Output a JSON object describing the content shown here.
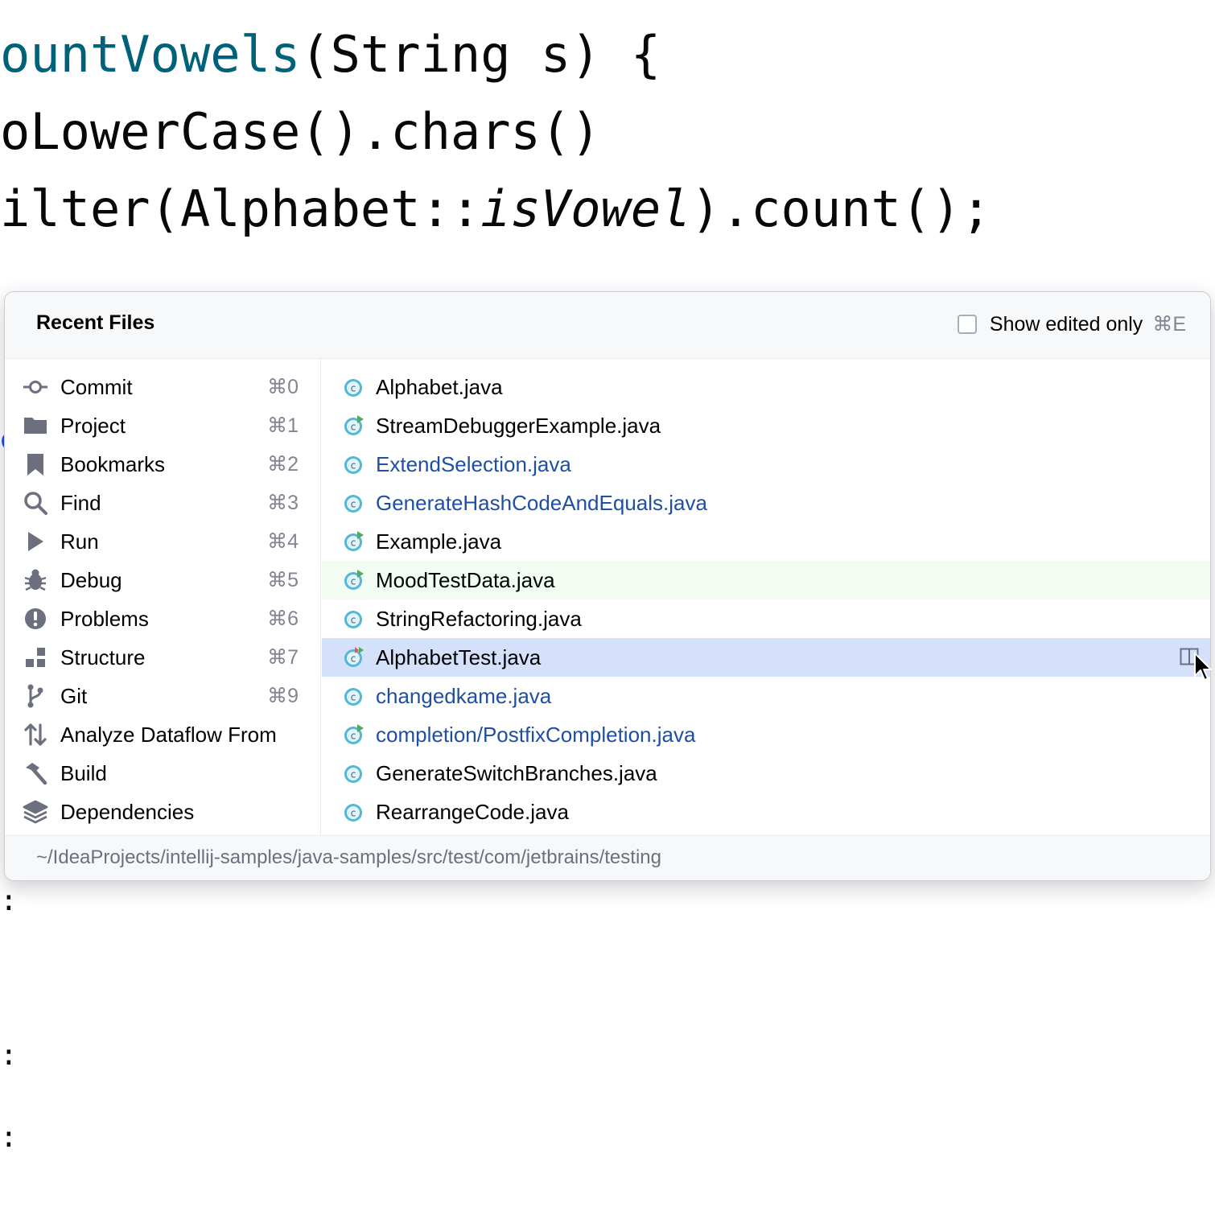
{
  "editor": {
    "line1": {
      "fn": "ountVowels",
      "rest": "(String s) {"
    },
    "line2": "oLowerCase().chars()",
    "line3": {
      "before": "ilter(Alphabet::",
      "italic": "isVowel",
      "after": ").count();"
    },
    "edge_marks": [
      {
        "text": "e",
        "color": "blue"
      },
      {
        "text": ":"
      },
      {
        "text": ":"
      },
      {
        "text": ":"
      },
      {
        "text": ":"
      },
      {
        "text": ":"
      }
    ]
  },
  "popup": {
    "title": "Recent Files",
    "show_edited": {
      "label": "Show edited only",
      "shortcut": "⌘E",
      "checked": false
    },
    "tool_windows": [
      {
        "label": "Commit",
        "shortcut": "⌘0",
        "icon": "commit-icon"
      },
      {
        "label": "Project",
        "shortcut": "⌘1",
        "icon": "folder-icon"
      },
      {
        "label": "Bookmarks",
        "shortcut": "⌘2",
        "icon": "bookmark-icon"
      },
      {
        "label": "Find",
        "shortcut": "⌘3",
        "icon": "search-icon"
      },
      {
        "label": "Run",
        "shortcut": "⌘4",
        "icon": "run-icon"
      },
      {
        "label": "Debug",
        "shortcut": "⌘5",
        "icon": "bug-icon"
      },
      {
        "label": "Problems",
        "shortcut": "⌘6",
        "icon": "problems-icon"
      },
      {
        "label": "Structure",
        "shortcut": "⌘7",
        "icon": "structure-icon"
      },
      {
        "label": "Git",
        "shortcut": "⌘9",
        "icon": "git-branch-icon"
      },
      {
        "label": "Analyze Dataflow From",
        "shortcut": "",
        "icon": "dataflow-icon"
      },
      {
        "label": "Build",
        "shortcut": "",
        "icon": "hammer-icon"
      },
      {
        "label": "Dependencies",
        "shortcut": "",
        "icon": "layers-icon"
      }
    ],
    "recent_files": [
      {
        "name": "Alphabet.java",
        "modified": false,
        "runnable": false
      },
      {
        "name": "StreamDebuggerExample.java",
        "modified": false,
        "runnable": true
      },
      {
        "name": "ExtendSelection.java",
        "modified": true,
        "runnable": false
      },
      {
        "name": "GenerateHashCodeAndEquals.java",
        "modified": true,
        "runnable": false
      },
      {
        "name": "Example.java",
        "modified": false,
        "runnable": true
      },
      {
        "name": "MoodTestData.java",
        "modified": false,
        "runnable": true,
        "state": "tinted"
      },
      {
        "name": "StringRefactoring.java",
        "modified": false,
        "runnable": false
      },
      {
        "name": "AlphabetTest.java",
        "modified": false,
        "runnable": true,
        "test": true,
        "state": "selected"
      },
      {
        "name": "changedkame.java",
        "modified": true,
        "runnable": false
      },
      {
        "name": "completion/PostfixCompletion.java",
        "modified": true,
        "runnable": true
      },
      {
        "name": "GenerateSwitchBranches.java",
        "modified": false,
        "runnable": false
      },
      {
        "name": "RearrangeCode.java",
        "modified": false,
        "runnable": false
      }
    ],
    "path": "~/IdeaProjects/intellij-samples/java-samples/src/test/com/jetbrains/testing"
  },
  "colors": {
    "selection": "#d5e1fb",
    "tint": "#f2fcf3",
    "modified_file": "#1e4fa3",
    "class_icon": "#56b6d6",
    "run_marker": "#55a76a"
  }
}
